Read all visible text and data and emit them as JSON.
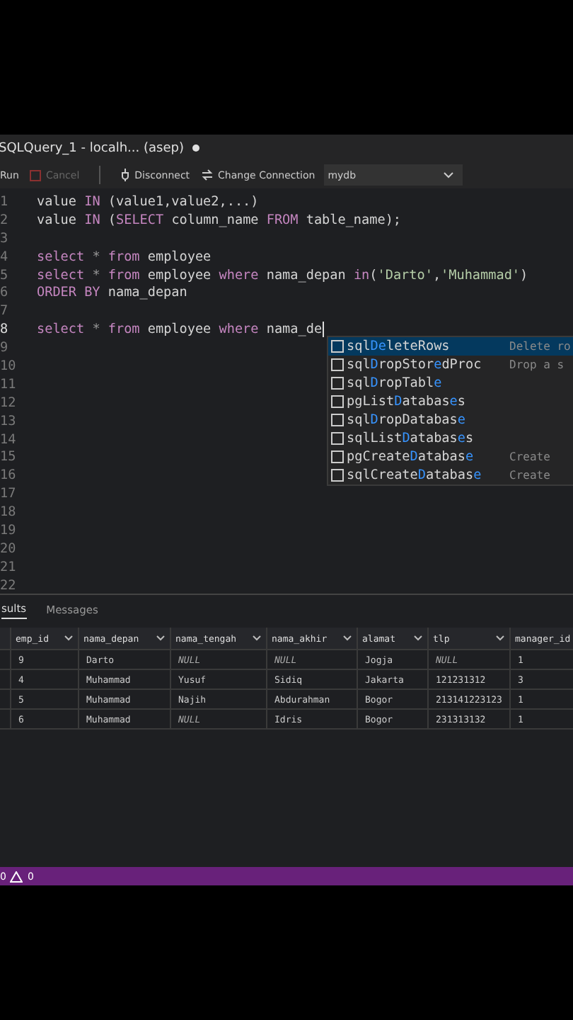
{
  "tab": {
    "title": "SQLQuery_1 - localh... (asep)",
    "unsaved": true
  },
  "toolbar": {
    "run": "Run",
    "cancel": {
      "label": "Cancel",
      "disabled": true
    },
    "disconnect": "Disconnect",
    "change_connection": "Change Connection",
    "database": "mydb"
  },
  "editor": {
    "lines": [
      {
        "number": "1",
        "tokens": [
          {
            "text": "value ",
            "kind": "plain"
          },
          {
            "text": "IN",
            "kind": "keyword"
          },
          {
            "text": " (value1,value2,...)",
            "kind": "plain"
          }
        ]
      },
      {
        "number": "2",
        "tokens": [
          {
            "text": "value ",
            "kind": "plain"
          },
          {
            "text": "IN",
            "kind": "keyword"
          },
          {
            "text": " (",
            "kind": "plain"
          },
          {
            "text": "SELECT",
            "kind": "keyword"
          },
          {
            "text": " column_name ",
            "kind": "plain"
          },
          {
            "text": "FROM",
            "kind": "keyword"
          },
          {
            "text": " table_name);",
            "kind": "plain"
          }
        ]
      },
      {
        "number": "3"
      },
      {
        "number": "4",
        "tokens": [
          {
            "text": "select",
            "kind": "keyword"
          },
          {
            "text": " * ",
            "kind": "operator"
          },
          {
            "text": "from",
            "kind": "keyword"
          },
          {
            "text": " employee",
            "kind": "plain"
          }
        ]
      },
      {
        "number": "5",
        "tokens": [
          {
            "text": "select",
            "kind": "keyword"
          },
          {
            "text": " * ",
            "kind": "operator"
          },
          {
            "text": "from",
            "kind": "keyword"
          },
          {
            "text": " employee ",
            "kind": "plain"
          },
          {
            "text": "where",
            "kind": "keyword"
          },
          {
            "text": " nama_depan ",
            "kind": "plain"
          },
          {
            "text": "in",
            "kind": "keyword"
          },
          {
            "text": "(",
            "kind": "plain"
          },
          {
            "text": "'Darto'",
            "kind": "string"
          },
          {
            "text": ",",
            "kind": "plain"
          },
          {
            "text": "'Muhammad'",
            "kind": "string"
          },
          {
            "text": ")",
            "kind": "plain"
          }
        ]
      },
      {
        "number": "6",
        "tokens": [
          {
            "text": "ORDER BY",
            "kind": "keyword"
          },
          {
            "text": " nama_depan",
            "kind": "plain"
          }
        ]
      },
      {
        "number": "7"
      },
      {
        "number": "8",
        "tokens": [
          {
            "text": "select",
            "kind": "keyword"
          },
          {
            "text": " * ",
            "kind": "operator"
          },
          {
            "text": "from",
            "kind": "keyword"
          },
          {
            "text": " employee ",
            "kind": "plain"
          },
          {
            "text": "where",
            "kind": "keyword"
          },
          {
            "text": " nama_de",
            "kind": "plain"
          }
        ],
        "cursor": true
      },
      {
        "number": "9"
      },
      {
        "number": "10"
      },
      {
        "number": "11"
      },
      {
        "number": "12"
      },
      {
        "number": "13"
      },
      {
        "number": "14"
      },
      {
        "number": "15"
      },
      {
        "number": "16"
      },
      {
        "number": "17"
      },
      {
        "number": "18"
      },
      {
        "number": "19"
      },
      {
        "number": "20"
      },
      {
        "number": "21"
      },
      {
        "number": "22"
      }
    ]
  },
  "suggestions": [
    {
      "parts": [
        {
          "text": "sql",
          "match": false
        },
        {
          "text": "De",
          "match": true
        },
        {
          "text": "leteRows",
          "match": false
        }
      ],
      "description": "Delete ro",
      "selected": true
    },
    {
      "parts": [
        {
          "text": "sql",
          "match": false
        },
        {
          "text": "D",
          "match": true
        },
        {
          "text": "ropStor",
          "match": false
        },
        {
          "text": "e",
          "match": true
        },
        {
          "text": "dProc",
          "match": false
        }
      ],
      "description": "Drop a s",
      "selected": false
    },
    {
      "parts": [
        {
          "text": "sql",
          "match": false
        },
        {
          "text": "D",
          "match": true
        },
        {
          "text": "ropTabl",
          "match": false
        },
        {
          "text": "e",
          "match": true
        }
      ],
      "selected": false
    },
    {
      "parts": [
        {
          "text": "pgList",
          "match": false
        },
        {
          "text": "D",
          "match": true
        },
        {
          "text": "atabas",
          "match": false
        },
        {
          "text": "e",
          "match": true
        },
        {
          "text": "s",
          "match": false
        }
      ],
      "selected": false
    },
    {
      "parts": [
        {
          "text": "sql",
          "match": false
        },
        {
          "text": "D",
          "match": true
        },
        {
          "text": "ropDatabas",
          "match": false
        },
        {
          "text": "e",
          "match": true
        }
      ],
      "selected": false
    },
    {
      "parts": [
        {
          "text": "sqlList",
          "match": false
        },
        {
          "text": "D",
          "match": true
        },
        {
          "text": "atabas",
          "match": false
        },
        {
          "text": "e",
          "match": true
        },
        {
          "text": "s",
          "match": false
        }
      ],
      "selected": false
    },
    {
      "parts": [
        {
          "text": "pgCreate",
          "match": false
        },
        {
          "text": "D",
          "match": true
        },
        {
          "text": "atabas",
          "match": false
        },
        {
          "text": "e",
          "match": true
        }
      ],
      "description": "Create",
      "selected": false
    },
    {
      "parts": [
        {
          "text": "sqlCreate",
          "match": false
        },
        {
          "text": "D",
          "match": true
        },
        {
          "text": "atabas",
          "match": false
        },
        {
          "text": "e",
          "match": true
        }
      ],
      "description": "Create",
      "selected": false
    }
  ],
  "results_tabs": [
    {
      "label": "sults",
      "selected": true
    },
    {
      "label": "Messages",
      "selected": false
    }
  ],
  "table": {
    "columns": [
      "emp_id",
      "nama_depan",
      "nama_tengah",
      "nama_akhir",
      "alamat",
      "tlp",
      "manager_id"
    ],
    "rows": [
      [
        {
          "text": "9",
          "null": false
        },
        {
          "text": "Darto",
          "null": false
        },
        {
          "text": "NULL",
          "null": true
        },
        {
          "text": "NULL",
          "null": true
        },
        {
          "text": "Jogja",
          "null": false
        },
        {
          "text": "NULL",
          "null": true
        },
        {
          "text": "1",
          "null": false
        }
      ],
      [
        {
          "text": "4",
          "null": false
        },
        {
          "text": "Muhammad",
          "null": false
        },
        {
          "text": "Yusuf",
          "null": false
        },
        {
          "text": "Sidiq",
          "null": false
        },
        {
          "text": "Jakarta",
          "null": false
        },
        {
          "text": "121231312",
          "null": false
        },
        {
          "text": "3",
          "null": false
        }
      ],
      [
        {
          "text": "5",
          "null": false
        },
        {
          "text": "Muhammad",
          "null": false
        },
        {
          "text": "Najih",
          "null": false
        },
        {
          "text": "Abdurahman",
          "null": false
        },
        {
          "text": "Bogor",
          "null": false
        },
        {
          "text": "213141223123",
          "null": false
        },
        {
          "text": "1",
          "null": false
        }
      ],
      [
        {
          "text": "6",
          "null": false
        },
        {
          "text": "Muhammad",
          "null": false
        },
        {
          "text": "NULL",
          "null": true
        },
        {
          "text": "Idris",
          "null": false
        },
        {
          "text": "Bogor",
          "null": false
        },
        {
          "text": "231313132",
          "null": false
        },
        {
          "text": "1",
          "null": false
        }
      ]
    ]
  },
  "status_bar": {
    "errors": "0",
    "warnings": "0"
  }
}
